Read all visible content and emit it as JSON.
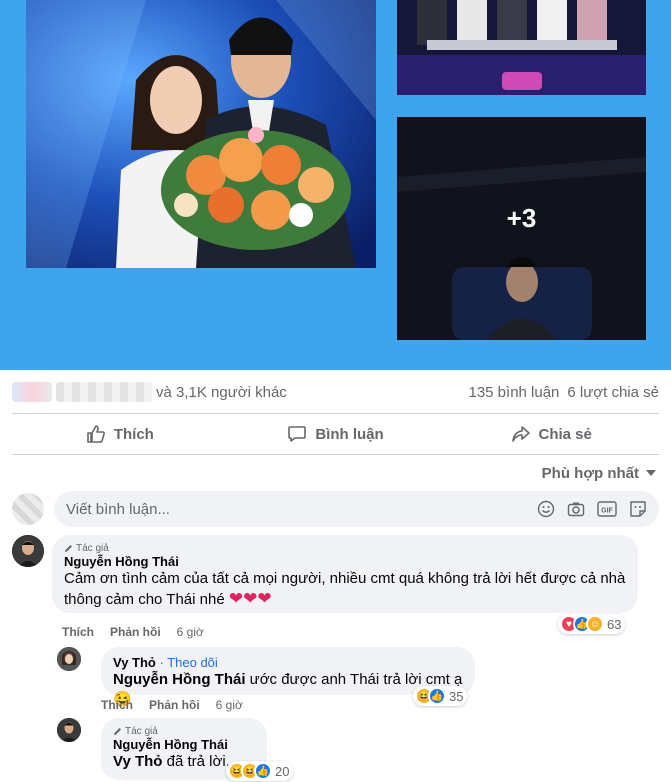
{
  "photos": {
    "more_count": "+3"
  },
  "stats": {
    "reactors_suffix": "và 3,1K người khác",
    "comments": "135 bình luận",
    "shares": "6 lượt chia sẻ"
  },
  "actions": {
    "like": "Thích",
    "comment": "Bình luận",
    "share": "Chia sẻ"
  },
  "sort": {
    "label": "Phù hợp nhất"
  },
  "composer": {
    "placeholder": "Viết bình luận..."
  },
  "comments": [
    {
      "badge": "Tác giả",
      "author": "Nguyễn Hồng Thái",
      "text_line1": "Cảm ơn tình cảm của tất cả mọi người, nhiều cmt quá không trả lời hết được cả nhà",
      "text_line2": "thông cảm cho Thái nhé",
      "like": "Thích",
      "reply": "Phản hồi",
      "time": "6 giờ",
      "reaction_count": "63"
    },
    {
      "author": "Vy Thỏ",
      "follow": "Theo dõi",
      "mention": "Nguyễn Hồng Thái",
      "text": "ước được anh Thái trả lời cmt ạ",
      "like": "Thích",
      "reply": "Phản hồi",
      "time": "6 giờ",
      "reaction_count": "35"
    },
    {
      "badge": "Tác giả",
      "author": "Nguyễn Hồng Thái",
      "mention": "Vy Thỏ",
      "text": "đã trả lời...",
      "reaction_count": "20"
    }
  ],
  "colors": {
    "photo_background": "#3ea4ec",
    "bubble": "#f0f2f5",
    "secondary_text": "#65676b",
    "link_blue": "#216fdb"
  }
}
